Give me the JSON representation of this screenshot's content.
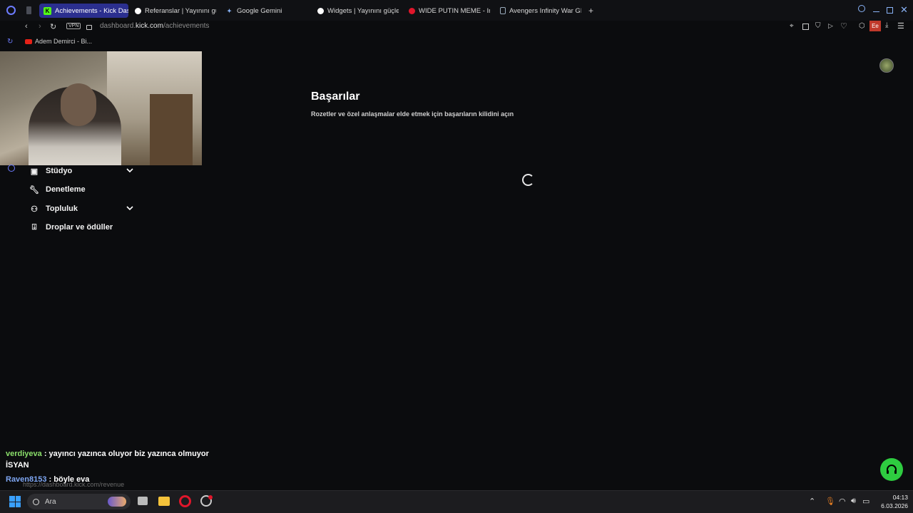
{
  "browser": {
    "tabs": [
      {
        "label": "Achievements - Kick Dash",
        "favicon": "kick-icon",
        "active": true
      },
      {
        "label": "Referanslar | Yayınını güç",
        "favicon": "streamelements-icon",
        "active": false
      },
      {
        "label": "Google Gemini",
        "favicon": "gemini-icon",
        "active": false
      },
      {
        "label": "Widgets | Yayınını güçlend",
        "favicon": "streamelements-icon",
        "active": false
      },
      {
        "label": "WIDE PUTIN MEME - Insta",
        "favicon": "opera-icon",
        "active": false
      },
      {
        "label": "Avengers Infinity War GIF",
        "favicon": "doc-icon",
        "active": false
      }
    ],
    "new_tab_label": "+",
    "vpn_label": "VPN",
    "url_prefix": "dashboard.",
    "url_domain": "kick.com",
    "url_path": "/achievements",
    "profile_badge": "Ee",
    "bookmark": "Adem Demirci - Bi..."
  },
  "sidebar": {
    "items": [
      {
        "label": "Stüdyo",
        "icon": "studio-icon",
        "expandable": true
      },
      {
        "label": "Denetleme",
        "icon": "wrench-icon",
        "expandable": false
      },
      {
        "label": "Topluluk",
        "icon": "community-icon",
        "expandable": true
      },
      {
        "label": "Droplar ve ödüller",
        "icon": "gift-icon",
        "expandable": false
      }
    ]
  },
  "main": {
    "title": "Başarılar",
    "subtitle": "Rozetler ve özel anlaşmalar elde etmek için başarıların kilidini açın"
  },
  "chat": [
    {
      "user": "verdiyeva",
      "sep": " : ",
      "message": "yayıncı yazınca oluyor biz yazınca olmuyor",
      "message2": "İSYAN"
    },
    {
      "user": "Raven8153",
      "sep": " : ",
      "message": "böyle eva"
    }
  ],
  "status_url": "https://dashboard.kick.com/revenue",
  "taskbar": {
    "search_placeholder": "Ara",
    "time": "04:13",
    "date": "6.03.2026"
  },
  "colors": {
    "accent_green": "#2ecc40",
    "tab_active": "#2b2f8f",
    "background": "#0b0c0e"
  }
}
